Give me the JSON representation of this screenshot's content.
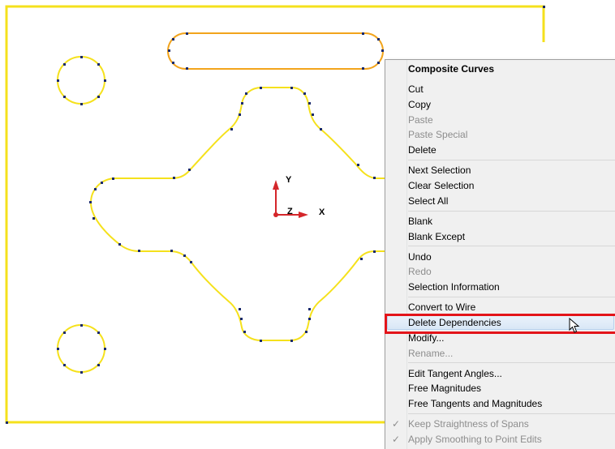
{
  "viewport": {
    "axis_labels": {
      "y": "Y",
      "z": "Z",
      "x": "X"
    },
    "colors": {
      "curve": "#f5e11c",
      "selected_curve": "#f2a41c",
      "point": "#1a2a6c",
      "axis_red": "#d4262a"
    }
  },
  "context_menu": {
    "title": "Composite Curves",
    "groups": [
      {
        "items": [
          {
            "label": "Cut",
            "enabled": true
          },
          {
            "label": "Copy",
            "enabled": true
          },
          {
            "label": "Paste",
            "enabled": false
          },
          {
            "label": "Paste Special",
            "enabled": false
          },
          {
            "label": "Delete",
            "enabled": true
          }
        ]
      },
      {
        "items": [
          {
            "label": "Next Selection",
            "enabled": true
          },
          {
            "label": "Clear Selection",
            "enabled": true
          },
          {
            "label": "Select All",
            "enabled": true
          }
        ]
      },
      {
        "items": [
          {
            "label": "Blank",
            "enabled": true
          },
          {
            "label": "Blank Except",
            "enabled": true
          }
        ]
      },
      {
        "items": [
          {
            "label": "Undo",
            "enabled": true
          },
          {
            "label": "Redo",
            "enabled": false
          },
          {
            "label": "Selection Information",
            "enabled": true
          }
        ]
      },
      {
        "items": [
          {
            "label": "Convert to Wire",
            "enabled": true
          },
          {
            "label": "Delete Dependencies",
            "enabled": true,
            "highlighted": true
          },
          {
            "label": "Modify...",
            "enabled": true
          },
          {
            "label": "Rename...",
            "enabled": false
          }
        ]
      },
      {
        "items": [
          {
            "label": "Edit Tangent Angles...",
            "enabled": true
          },
          {
            "label": "Free Magnitudes",
            "enabled": true
          },
          {
            "label": "Free Tangents and Magnitudes",
            "enabled": true
          }
        ]
      },
      {
        "items": [
          {
            "label": "Keep Straightness of Spans",
            "enabled": false,
            "checked": true
          },
          {
            "label": "Apply Smoothing to Point Edits",
            "enabled": false,
            "checked": true
          }
        ]
      }
    ],
    "check_glyph": "✓"
  },
  "annotation": {
    "highlight_color": "#e3141a"
  }
}
